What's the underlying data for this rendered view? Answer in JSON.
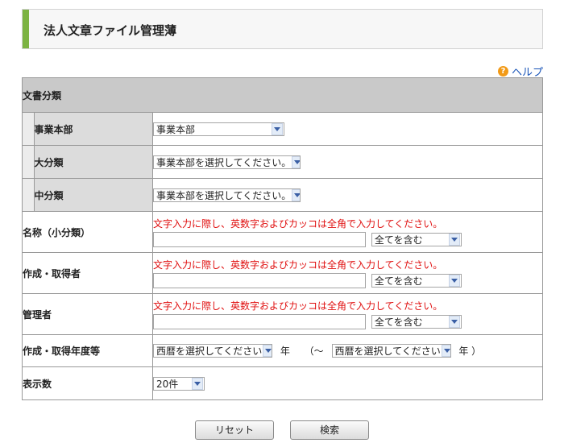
{
  "page": {
    "title": "法人文章ファイル管理薄"
  },
  "help": {
    "label": "ヘルプ",
    "icon": "help-question-icon"
  },
  "form": {
    "section_title": "文書分類",
    "department": {
      "label": "事業本部",
      "value": "事業本部"
    },
    "major_category": {
      "label": "大分類",
      "value": "事業本部を選択してください。"
    },
    "middle_category": {
      "label": "中分類",
      "value": "事業本部を選択してください。"
    },
    "name": {
      "label": "名称（小分類）",
      "note": "文字入力に際し、英数字およびカッコは全角で入力してください。",
      "value": "",
      "match": "全てを含む"
    },
    "creator": {
      "label": "作成・取得者",
      "note": "文字入力に際し、英数字およびカッコは全角で入力してください。",
      "value": "",
      "match": "全てを含む"
    },
    "manager": {
      "label": "管理者",
      "note": "文字入力に際し、英数字およびカッコは全角で入力してください。",
      "value": "",
      "match": "全てを含む"
    },
    "fiscal_year": {
      "label": "作成・取得年度等",
      "from": "西暦を選択してください",
      "year_unit": "年",
      "range_open": "（～",
      "to": "西暦を選択してください",
      "year_unit_end": "年 ）"
    },
    "display_count": {
      "label": "表示数",
      "value": "20件"
    }
  },
  "buttons": {
    "reset": "リセット",
    "search": "検索"
  },
  "colors": {
    "accent_bar": "#7cb342",
    "note_red": "#e01010",
    "help_link": "#1a55b8",
    "help_icon": "#f29a17"
  }
}
